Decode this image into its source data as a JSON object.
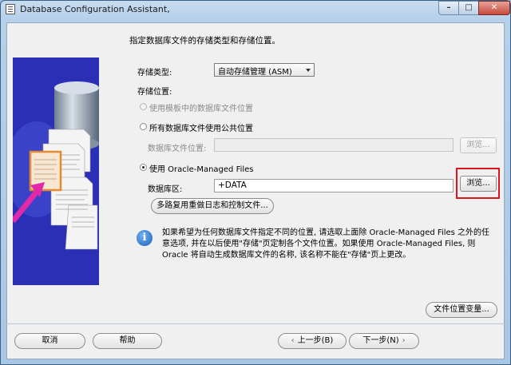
{
  "window": {
    "title": "Database Configuration Assistant,"
  },
  "page": {
    "instruction": "指定数据库文件的存储类型和存储位置。",
    "storage_type_label": "存储类型:",
    "storage_type_value": "自动存储管理 (ASM)",
    "storage_location_label": "存储位置:",
    "radio_template": "使用模板中的数据库文件位置",
    "radio_common": "所有数据库文件使用公共位置",
    "file_location_label": "数据库文件位置:",
    "file_location_value": "",
    "browse_label": "浏览...",
    "radio_omf": "使用 Oracle-Managed Files",
    "db_area_label": "数据库区:",
    "db_area_value": "+DATA",
    "multiplex_button": "多路复用重做日志和控制文件...",
    "info_text": "如果希望为任何数据库文件指定不同的位置, 请选取上面除 Oracle-Managed Files 之外的任意选项, 并在以后使用\"存储\"页定制各个文件位置。如果使用 Oracle-Managed Files, 则 Oracle 将自动生成数据库文件的名称, 该名称不能在\"存储\"页上更改。",
    "file_location_vars_button": "文件位置变量..."
  },
  "footer": {
    "cancel": "取消",
    "help": "帮助",
    "back": "上一步(B)",
    "next": "下一步(N)"
  },
  "colors": {
    "highlight": "#e0141e",
    "illustration_bg": "#2b2fb6"
  }
}
